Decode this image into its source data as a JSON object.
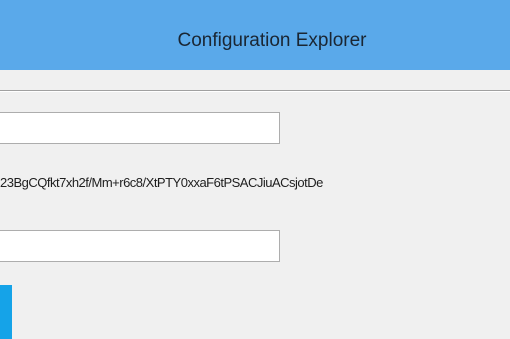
{
  "window": {
    "title": "Configuration Explorer"
  },
  "form": {
    "field1_value": "",
    "key_value": "23BgCQfkt7xh2f/Mm+r6c8/XtPTY0xxaF6tPSACJiuACsjotDe",
    "field2_value": ""
  },
  "colors": {
    "titlebar": "#5aa9ea",
    "body": "#f0f0f0",
    "accent": "#15a3e8"
  }
}
